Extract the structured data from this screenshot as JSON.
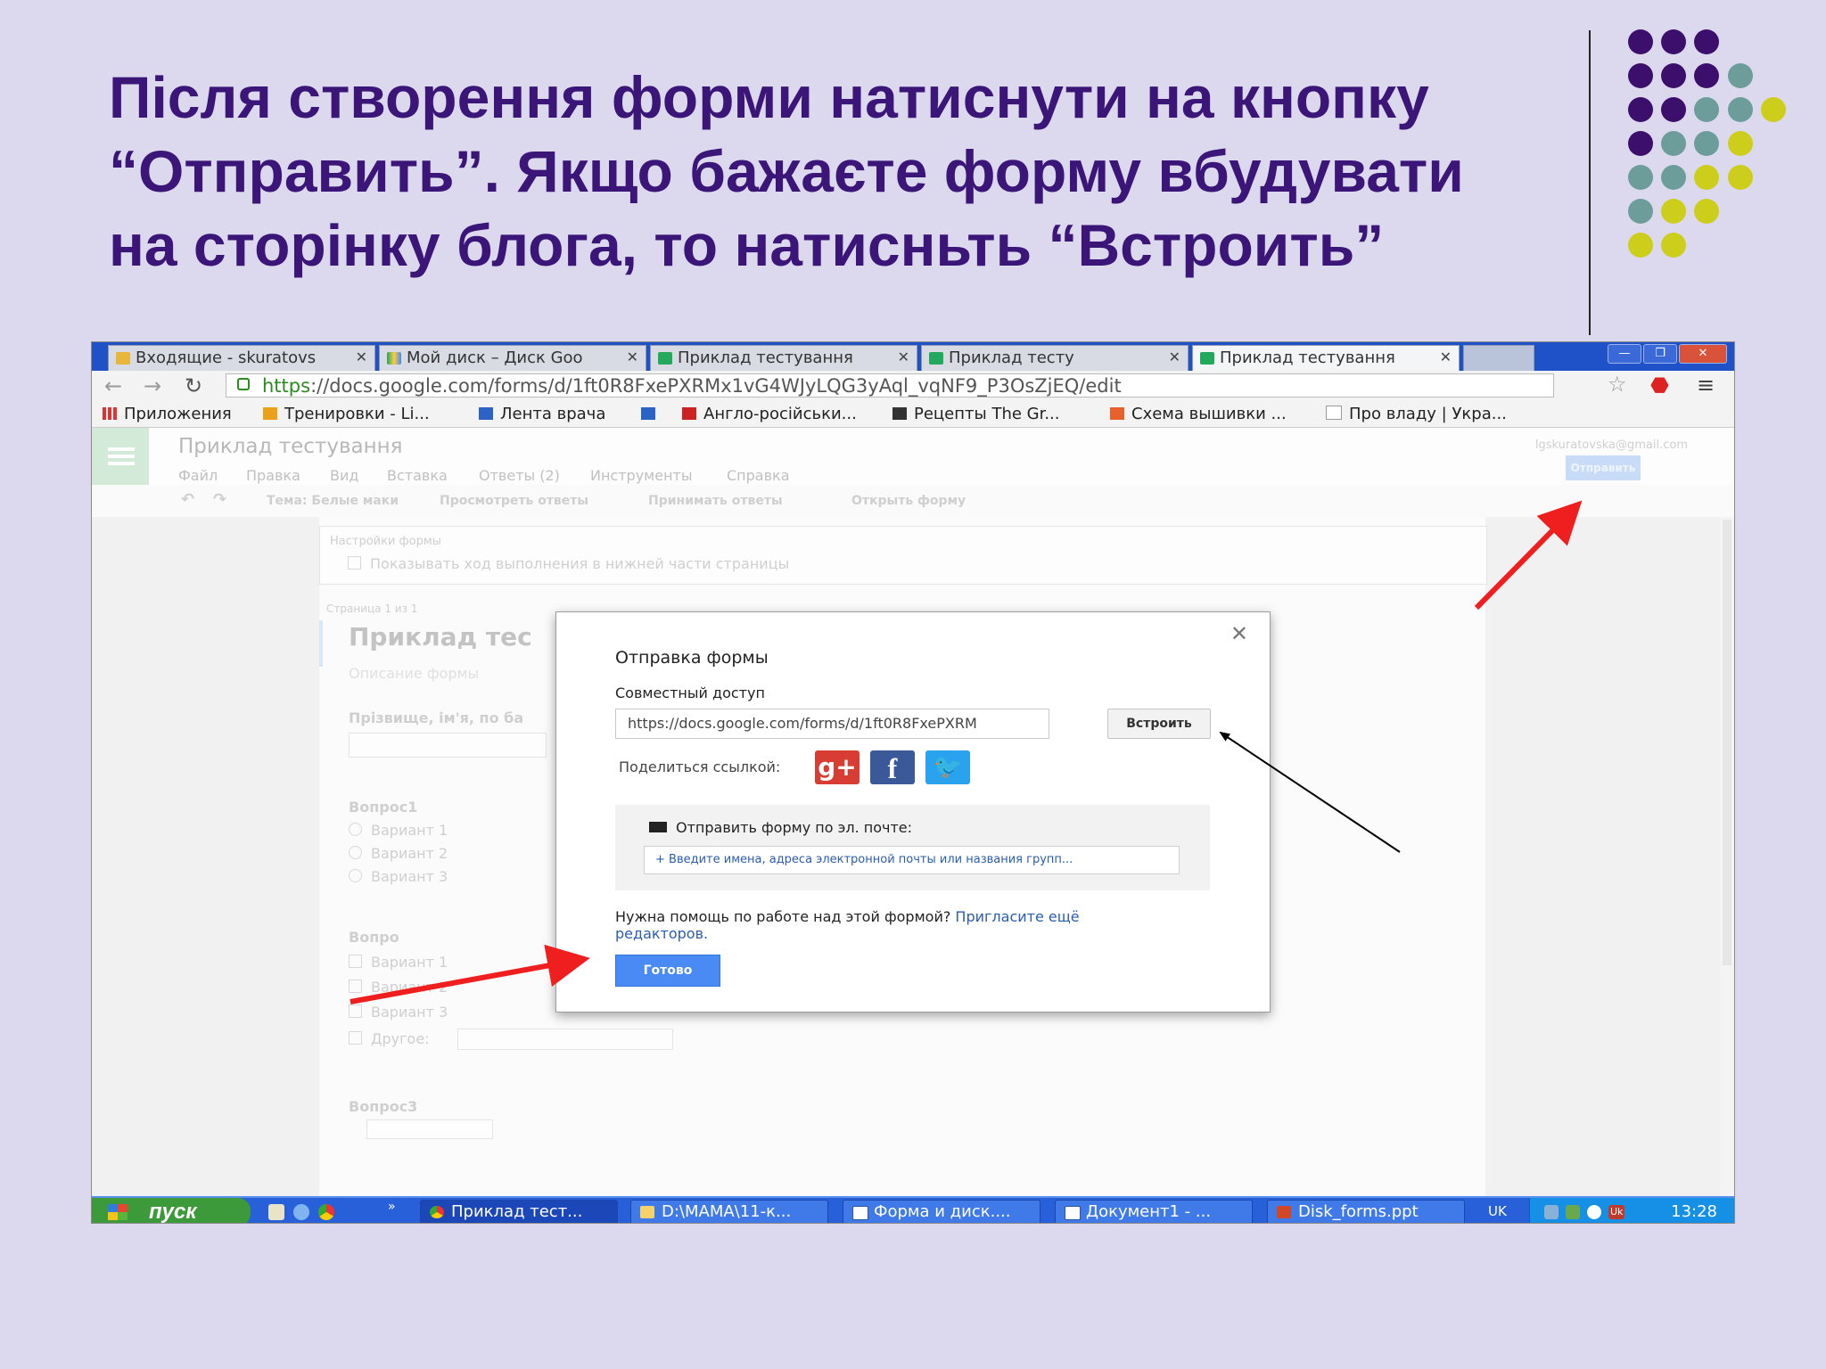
{
  "slide": {
    "title_lines": [
      "Після створення форми натиснути на кнопку",
      "“Отправить”. Якщо бажаєте форму вбудувати",
      "на сторінку блога, то натисньть “Встроить”"
    ]
  },
  "colors": {
    "title": "#3b1577",
    "dot_purple": "#3b0f6b",
    "dot_teal": "#6c9d9b",
    "dot_yellow": "#cdcd1c",
    "arrow_red": "#ef1f1f"
  },
  "browser": {
    "tabs": [
      {
        "label": "Входящие - skuratovs",
        "icon": "gmail-icon"
      },
      {
        "label": "Мой диск – Диск Goo",
        "icon": "drive-icon"
      },
      {
        "label": "Приклад тестування",
        "icon": "forms-icon"
      },
      {
        "label": "Приклад тесту",
        "icon": "forms-icon"
      },
      {
        "label": "Приклад тестування",
        "icon": "forms-icon"
      }
    ],
    "url_scheme": "https",
    "url_rest": "://docs.google.com/forms/d/1ft0R8FxePXRMx1vG4WJyLQG3yAql_vqNF9_P3OsZjEQ/edit",
    "bookmarks": [
      "Приложения",
      "Тренировки - Li...",
      "Лента врача",
      "Англо-російськи...",
      "Рецепты The Gr...",
      "Схема вышивки ...",
      "Про владу | Укра..."
    ]
  },
  "forms": {
    "doc_title": "Приклад тестування",
    "menu": [
      "Файл",
      "Правка",
      "Вид",
      "Вставка",
      "Ответы (2)",
      "Инструменты",
      "Справка"
    ],
    "account": "lgskuratovska@gmail.com",
    "send_button": "Отправить",
    "toolbar": [
      "Тема: Белые маки",
      "Просмотреть ответы",
      "Принимать ответы",
      "Открыть форму"
    ],
    "settings_header": "Настройки формы",
    "settings_option": "Показывать ход выполнения в нижней части страницы",
    "page_label": "Страница 1 из 1",
    "form_title": "Приклад тес",
    "form_desc": "Описание формы",
    "q_name": "Прізвище, ім'я, по ба",
    "q1": "Вопрос1",
    "q2": "Вопро",
    "q3": "Вопрос3",
    "opt1": "Вариант 1",
    "opt2": "Вариант 2",
    "opt3": "Вариант 3",
    "other": "Другое:"
  },
  "dialog": {
    "title": "Отправка формы",
    "sharing_label": "Совместный доступ",
    "link_value": "https://docs.google.com/forms/d/1ft0R8FxePXRM",
    "embed_button": "Встроить",
    "share_label": "Поделиться ссылкой:",
    "email_heading": "Отправить форму по эл. почте:",
    "email_placeholder": "+ Введите имена, адреса электронной почты или названия групп...",
    "help_text": "Нужна помощь по работе над этой формой?",
    "help_link": "Пригласите ещё редакторов.",
    "done_button": "Готово"
  },
  "taskbar": {
    "start": "пуск",
    "tasks": [
      "Приклад тест...",
      "D:\\МАМА\\11-к...",
      "Форма и диск....",
      "Документ1 - ...",
      "Disk_forms.ppt"
    ],
    "lang": "UK",
    "tray_lang": "Uk",
    "time": "13:28"
  }
}
